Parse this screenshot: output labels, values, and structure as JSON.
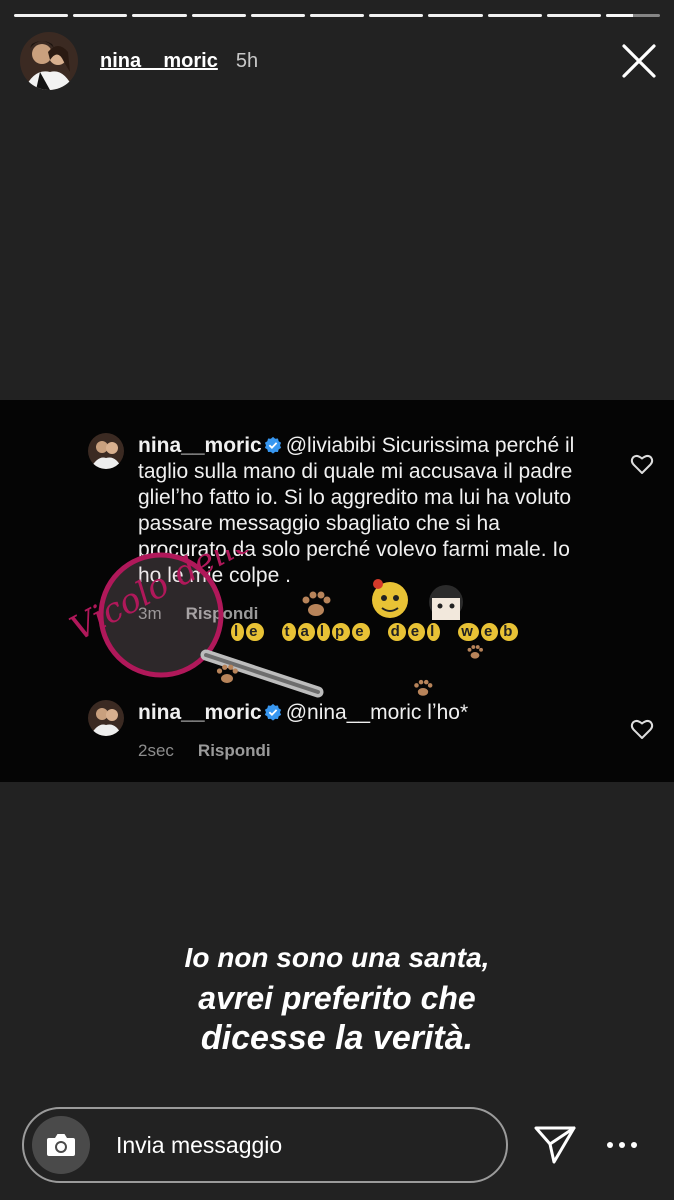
{
  "story": {
    "segments_total": 11,
    "segments_done": 10,
    "current_progress": 0.5,
    "username": "nina__moric",
    "time_ago": "5h"
  },
  "comments": [
    {
      "username": "nina__moric",
      "mention": "@liviabibi",
      "text": " Sicurissima perché il taglio sulla mano di quale mi accusava il padre glielʼho fatto io. Si lo aggredito ma lui ha voluto passare messaggio sbagliato che si ha procurato da solo perché volevo farmi male. Io ho le mie colpe .",
      "time": "3m",
      "reply_label": "Rispondi"
    },
    {
      "username": "nina__moric",
      "mention": "@nina__moric",
      "text": " lʼho*",
      "time": "2sec",
      "reply_label": "Rispondi"
    }
  ],
  "watermark": {
    "text": "le talpe del web",
    "logo_text": "Vicolo delle News"
  },
  "caption": {
    "line1": "Io non sono una santa,",
    "line2": "avrei preferito che",
    "line3": "dicesse la verità."
  },
  "footer": {
    "message_placeholder": "Invia messaggio"
  },
  "colors": {
    "background": "#222222",
    "comment_bg": "#050505",
    "verified": "#3897f0",
    "watermark_gold": "#e8c235",
    "watermark_magenta": "#b0185a"
  }
}
